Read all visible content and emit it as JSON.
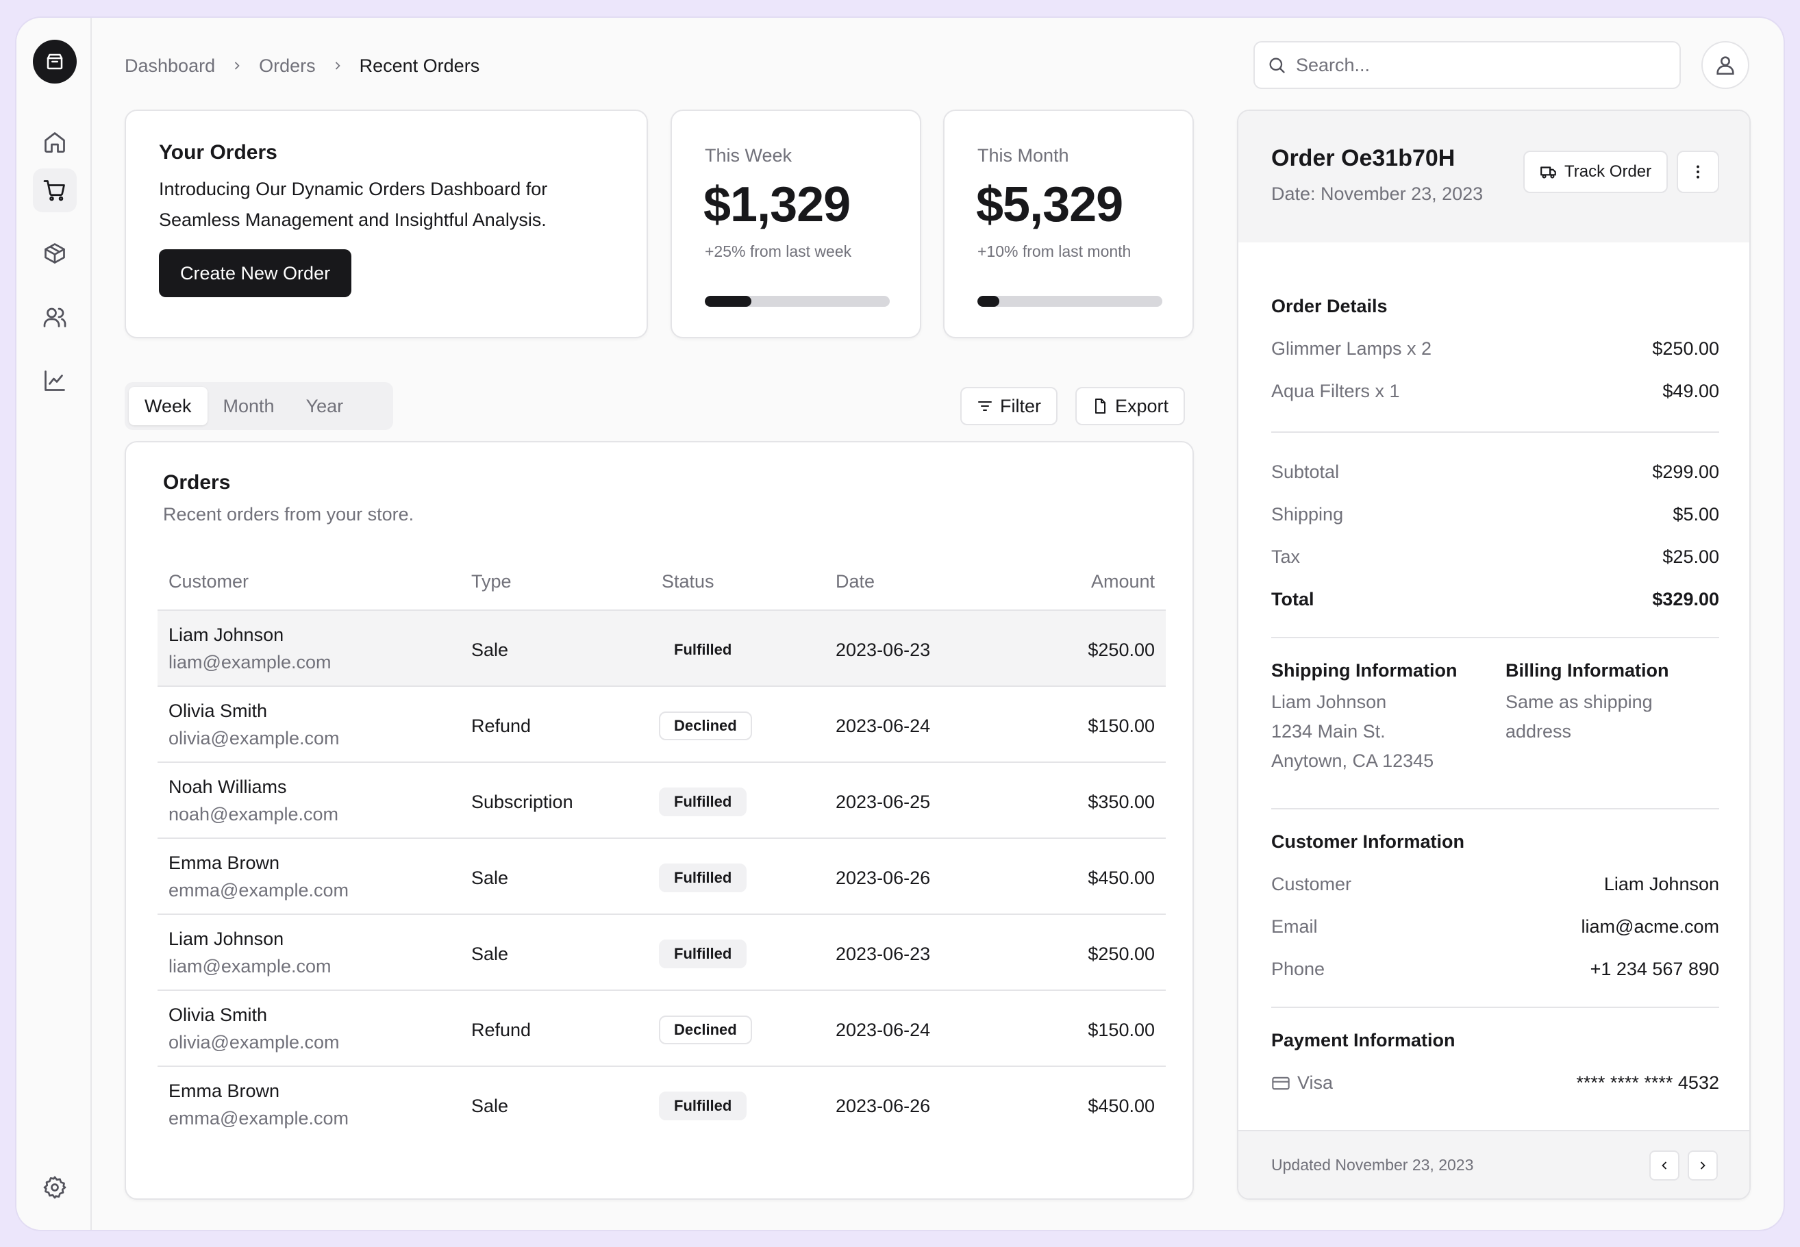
{
  "sidebar": {
    "logo_icon": "package-icon",
    "items": [
      {
        "name": "home",
        "icon": "home-icon"
      },
      {
        "name": "orders",
        "icon": "shopping-cart-icon",
        "active": true
      },
      {
        "name": "products",
        "icon": "package-icon"
      },
      {
        "name": "customers",
        "icon": "users-icon"
      },
      {
        "name": "analytics",
        "icon": "line-chart-icon"
      }
    ],
    "settings_icon": "gear-icon"
  },
  "breadcrumb": [
    "Dashboard",
    "Orders",
    "Recent Orders"
  ],
  "search": {
    "placeholder": "Search..."
  },
  "intro": {
    "title": "Your Orders",
    "description": "Introducing Our Dynamic Orders Dashboard for Seamless Management and Insightful Analysis.",
    "button": "Create New Order"
  },
  "stats": [
    {
      "label": "This Week",
      "value": "$1,329",
      "delta": "+25% from last week",
      "progress": 0.25
    },
    {
      "label": "This Month",
      "value": "$5,329",
      "delta": "+10% from last month",
      "progress": 0.12
    }
  ],
  "tabs": [
    {
      "label": "Week",
      "active": true
    },
    {
      "label": "Month"
    },
    {
      "label": "Year"
    }
  ],
  "actions": {
    "filter": "Filter",
    "export": "Export"
  },
  "orders": {
    "title": "Orders",
    "subtitle": "Recent orders from your store.",
    "columns": [
      "Customer",
      "Type",
      "Status",
      "Date",
      "Amount"
    ],
    "rows": [
      {
        "name": "Liam Johnson",
        "email": "liam@example.com",
        "type": "Sale",
        "status": "Fulfilled",
        "date": "2023-06-23",
        "amount": "$250.00"
      },
      {
        "name": "Olivia Smith",
        "email": "olivia@example.com",
        "type": "Refund",
        "status": "Declined",
        "date": "2023-06-24",
        "amount": "$150.00"
      },
      {
        "name": "Noah Williams",
        "email": "noah@example.com",
        "type": "Subscription",
        "status": "Fulfilled",
        "date": "2023-06-25",
        "amount": "$350.00"
      },
      {
        "name": "Emma Brown",
        "email": "emma@example.com",
        "type": "Sale",
        "status": "Fulfilled",
        "date": "2023-06-26",
        "amount": "$450.00"
      },
      {
        "name": "Liam Johnson",
        "email": "liam@example.com",
        "type": "Sale",
        "status": "Fulfilled",
        "date": "2023-06-23",
        "amount": "$250.00"
      },
      {
        "name": "Olivia Smith",
        "email": "olivia@example.com",
        "type": "Refund",
        "status": "Declined",
        "date": "2023-06-24",
        "amount": "$150.00"
      },
      {
        "name": "Emma Brown",
        "email": "emma@example.com",
        "type": "Sale",
        "status": "Fulfilled",
        "date": "2023-06-26",
        "amount": "$450.00"
      }
    ]
  },
  "detail": {
    "order_id": "Order Oe31b70H",
    "date": "Date: November 23, 2023",
    "track_button": "Track Order",
    "order_details_title": "Order Details",
    "items": [
      {
        "label": "Glimmer Lamps x 2",
        "value": "$250.00"
      },
      {
        "label": "Aqua Filters x 1",
        "value": "$49.00"
      }
    ],
    "summary": [
      {
        "label": "Subtotal",
        "value": "$299.00"
      },
      {
        "label": "Shipping",
        "value": "$5.00"
      },
      {
        "label": "Tax",
        "value": "$25.00"
      },
      {
        "label": "Total",
        "value": "$329.00"
      }
    ],
    "shipping_title": "Shipping Information",
    "shipping_lines": [
      "Liam Johnson",
      "1234 Main St.",
      "Anytown, CA 12345"
    ],
    "billing_title": "Billing Information",
    "billing_lines": [
      "Same as shipping",
      "address"
    ],
    "customer_title": "Customer Information",
    "customer": [
      {
        "label": "Customer",
        "value": "Liam Johnson"
      },
      {
        "label": "Email",
        "value": "liam@acme.com"
      },
      {
        "label": "Phone",
        "value": "+1 234 567 890"
      }
    ],
    "payment_title": "Payment Information",
    "payment": {
      "method": "Visa",
      "card": "**** **** **** 4532",
      "icon": "credit-card-icon"
    },
    "updated": "Updated November 23, 2023"
  }
}
